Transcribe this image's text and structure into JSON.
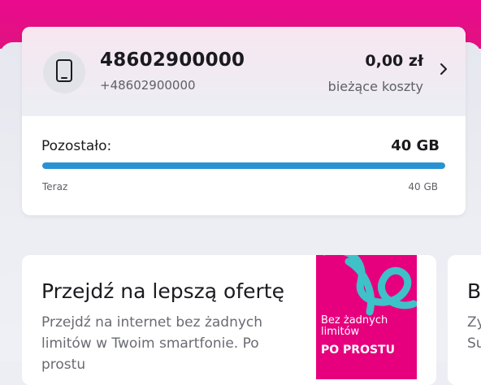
{
  "account": {
    "number": "48602900000",
    "number_intl": "+48602900000",
    "amount": "0,00 zł",
    "amount_label": "bieżące koszty"
  },
  "data_usage": {
    "remaining_label": "Pozostało:",
    "remaining_value": "40 GB",
    "bar_fraction": 1.0,
    "bar_left_label": "Teraz",
    "bar_right_label": "40 GB"
  },
  "offer": {
    "title": "Przejdź na lepszą ofertę",
    "description": "Przejdź na internet bez żadnych limitów w Twoim smartfonie. Po prostu",
    "promo_text": "Bez żadnych limitów",
    "promo_big": "PO PROSTU"
  },
  "next_card": {
    "title": "B",
    "desc_lines": "Zy Su"
  },
  "colors": {
    "brand": "#e20074",
    "bar": "#2a92d2"
  },
  "icons": {
    "avatar": "smartphone-icon",
    "chevron": "chevron-right-icon"
  }
}
